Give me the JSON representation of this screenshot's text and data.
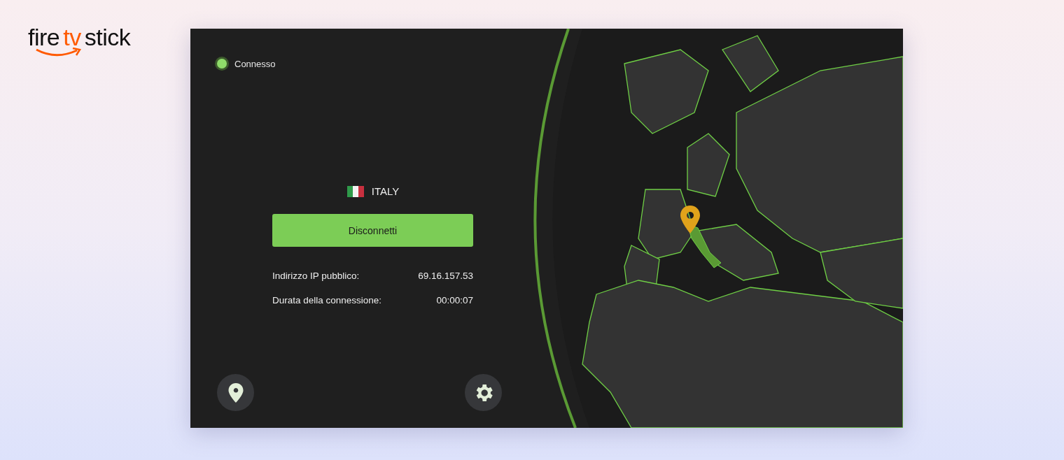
{
  "brand": {
    "logo": [
      {
        "text": "fire",
        "accent": false
      },
      {
        "text": "tv",
        "accent": true
      },
      {
        "text": "stick",
        "accent": false
      }
    ]
  },
  "status": {
    "label": "Connesso",
    "connected": true
  },
  "server": {
    "country": "ITALY"
  },
  "disconnect_button": {
    "label": "Disconnetti"
  },
  "details": [
    {
      "label": "Indirizzo IP pubblico:",
      "value": "69.16.157.53"
    },
    {
      "label": "Durata della connessione:",
      "value": "00:00:07"
    }
  ]
}
